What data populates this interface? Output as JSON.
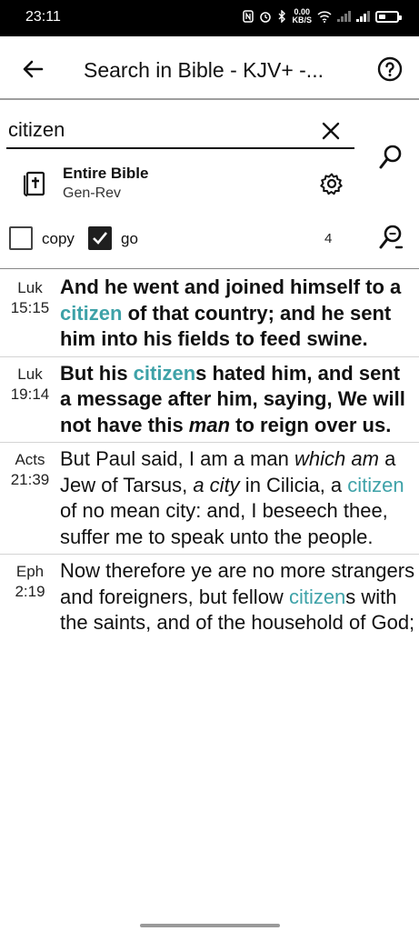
{
  "status_bar": {
    "time": "23:11",
    "net_speed_value": "0.00",
    "net_speed_unit": "KB/S"
  },
  "app_bar": {
    "title": "Search in Bible - KJV+ -..."
  },
  "search": {
    "query": "citizen"
  },
  "scope": {
    "title": "Entire Bible",
    "range": "Gen-Rev"
  },
  "options": {
    "copy_label": "copy",
    "copy_checked": false,
    "go_label": "go",
    "go_checked": true,
    "result_count": "4"
  },
  "colors": {
    "highlight": "#3ea2a8"
  },
  "results": [
    {
      "book": "Luk",
      "ref": "15:15",
      "bold": true,
      "segments": [
        {
          "t": "And he went and joined himself to a "
        },
        {
          "t": "citizen",
          "hl": true
        },
        {
          "t": " of that country; and he sent him into his fields to feed swine."
        }
      ]
    },
    {
      "book": "Luk",
      "ref": "19:14",
      "bold": true,
      "segments": [
        {
          "t": "But his "
        },
        {
          "t": "citizen",
          "hl": true
        },
        {
          "t": "s hated him, and sent a message after him, saying, We will not have this "
        },
        {
          "t": "man",
          "it": true
        },
        {
          "t": " to reign over us."
        }
      ]
    },
    {
      "book": "Acts",
      "ref": "21:39",
      "bold": false,
      "segments": [
        {
          "t": "But Paul said, I am a man "
        },
        {
          "t": "which am",
          "it": true
        },
        {
          "t": " a Jew of Tarsus, "
        },
        {
          "t": "a city",
          "it": true
        },
        {
          "t": " in Cilicia, a "
        },
        {
          "t": "citizen",
          "hl": true
        },
        {
          "t": " of no mean city: and, I beseech thee, suffer me to speak unto the people."
        }
      ]
    },
    {
      "book": "Eph",
      "ref": "2:19",
      "bold": false,
      "segments": [
        {
          "t": "Now therefore ye are no more strangers and foreigners, but fellow "
        },
        {
          "t": "citizen",
          "hl": true
        },
        {
          "t": "s with the saints, and of the household of God;"
        }
      ]
    }
  ]
}
